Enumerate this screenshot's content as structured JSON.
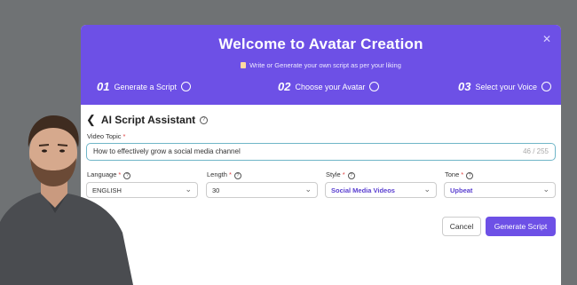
{
  "modal": {
    "title": "Welcome to Avatar Creation",
    "subtitle": "Write or Generate your own script as per your liking",
    "close_icon": "close-icon",
    "steps": [
      {
        "num": "01",
        "label": "Generate a Script"
      },
      {
        "num": "02",
        "label": "Choose your Avatar"
      },
      {
        "num": "03",
        "label": "Select your Voice"
      }
    ]
  },
  "assistant": {
    "title": "AI Script Assistant"
  },
  "form": {
    "video_topic_label": "Video Topic",
    "video_topic_value": "How to effectively grow a social media channel",
    "video_topic_count": "46 / 255",
    "language_label": "Language",
    "language_value": "ENGLISH",
    "length_label": "Length",
    "length_value": "30",
    "style_label": "Style",
    "style_value": "Social Media Videos",
    "tone_label": "Tone",
    "tone_value": "Upbeat",
    "required_mark": "*"
  },
  "buttons": {
    "cancel": "Cancel",
    "generate": "Generate Script"
  },
  "colors": {
    "accent": "#6d50e6",
    "background": "#6f7274",
    "focus_border": "#70b6c8"
  }
}
